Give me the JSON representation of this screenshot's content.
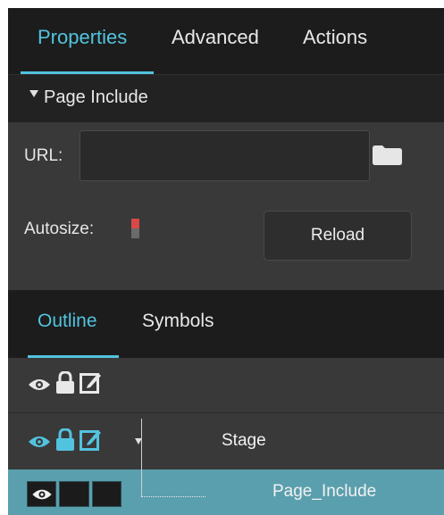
{
  "tabs": {
    "properties": "Properties",
    "advanced": "Advanced",
    "actions": "Actions"
  },
  "section": {
    "title": "Page Include"
  },
  "properties": {
    "url_label": "URL:",
    "url_value": "",
    "url_placeholder": "",
    "autosize_label": "Autosize:",
    "autosize_on": false,
    "reload_label": "Reload"
  },
  "outline_tabs": {
    "outline": "Outline",
    "symbols": "Symbols"
  },
  "outline": {
    "rows": [
      {
        "label": ""
      },
      {
        "label": "Stage"
      },
      {
        "label": "Page_Include"
      }
    ]
  },
  "icons": [
    "eye-icon",
    "lock-icon",
    "edit-icon",
    "folder-icon",
    "triangle-down-icon"
  ],
  "colors": {
    "accent": "#52c3df",
    "panel_dark": "#1c1c1c",
    "panel": "#393939",
    "selected_row": "#5a9fad",
    "toggle_red": "#d94848"
  }
}
